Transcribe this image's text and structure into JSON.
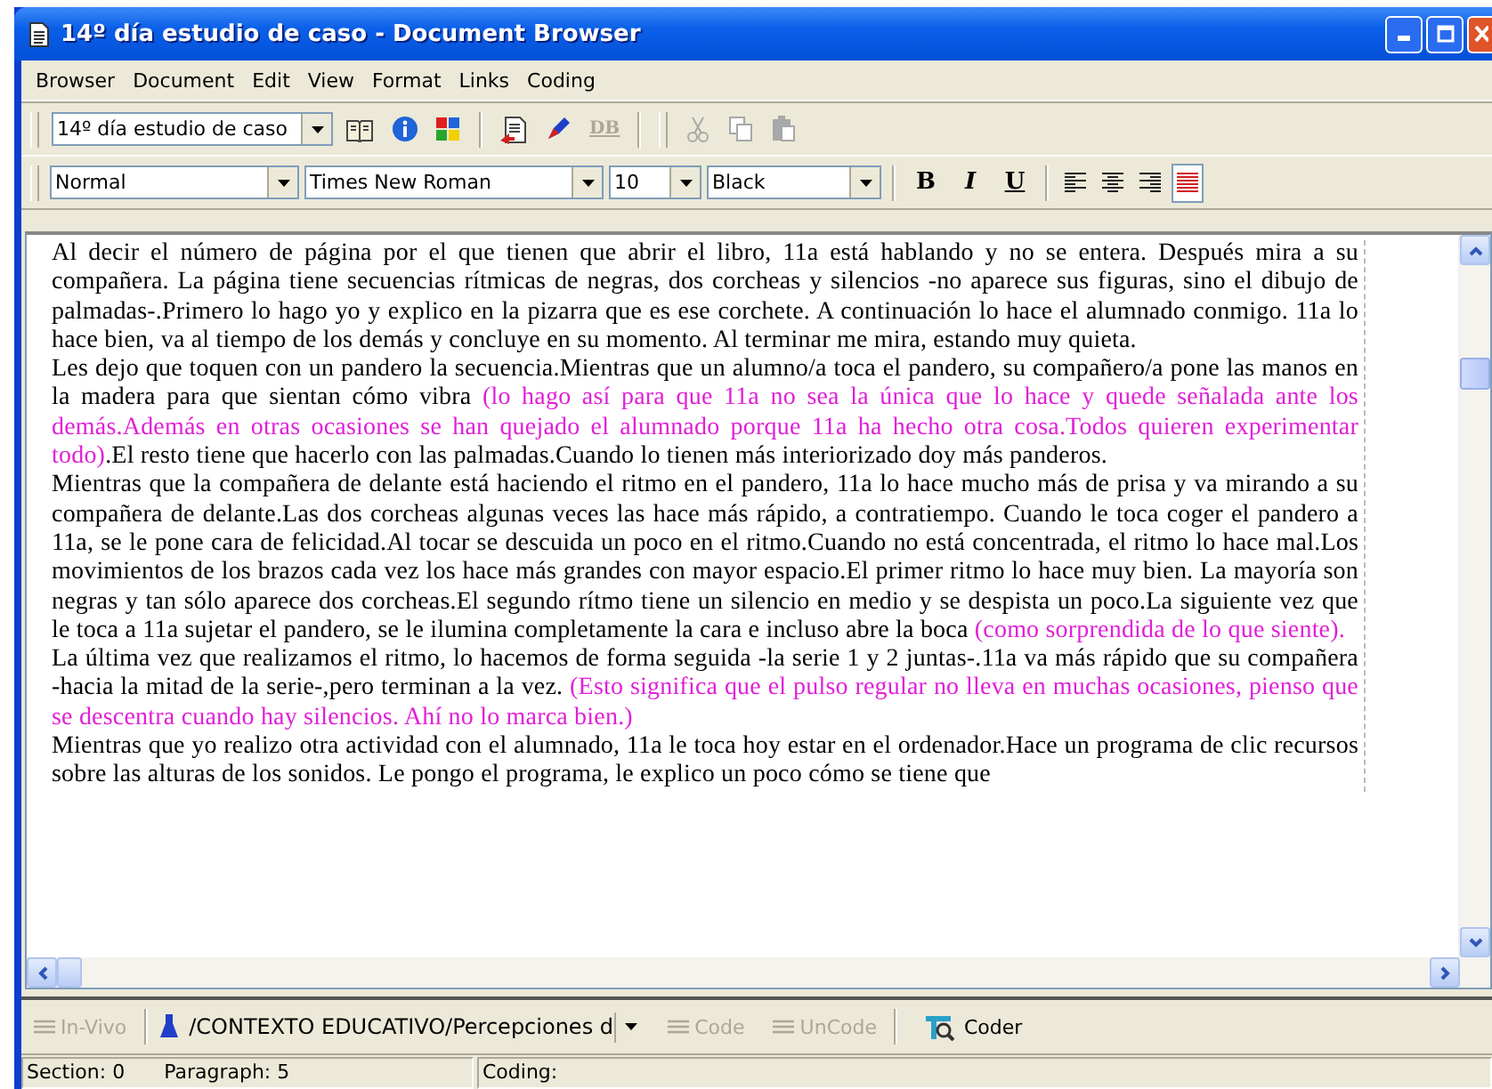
{
  "window": {
    "title": "14º día estudio de caso - Document Browser"
  },
  "menu": [
    "Browser",
    "Document",
    "Edit",
    "View",
    "Format",
    "Links",
    "Coding"
  ],
  "document_toolbar": {
    "document": "14º día estudio de caso",
    "db_button": {
      "label": "DB",
      "disabled": true
    },
    "edit_buttons": [
      {
        "disabled": true
      },
      {
        "disabled": true
      },
      {
        "disabled": true
      }
    ]
  },
  "format_toolbar": {
    "style": "Normal",
    "font": "Times New Roman",
    "size": "10",
    "text_color": "Black",
    "format_buttons": [
      {
        "label": "B",
        "pressed": false
      },
      {
        "label": "I",
        "pressed": false
      },
      {
        "label": "U",
        "pressed": false
      }
    ],
    "align_buttons": [
      {
        "pressed": false
      },
      {
        "pressed": false
      },
      {
        "pressed": false
      },
      {
        "pressed": true
      }
    ]
  },
  "document": {
    "paragraphs": [
      [
        {
          "kind": "text",
          "text": "Al decir el número de página por el que tienen que abrir el libro, 11a está hablando y no se entera. Después mira a su compañera. La página tiene secuencias rítmicas de negras, dos corcheas y silencios -no aparece sus figuras, sino el dibujo de palmadas-.Primero lo hago yo y explico en la pizarra que es ese corchete. A continuación lo hace el alumnado conmigo. 11a lo hace bien, va al tiempo de los demás y concluye en su momento. Al terminar me mira, estando muy quieta."
        }
      ],
      [
        {
          "kind": "text",
          "text": "Les dejo que toquen con un pandero la secuencia.Mientras que un alumno/a toca el pandero, su compañero/a pone las manos en la madera para que sientan cómo vibra "
        },
        {
          "kind": "memo",
          "text": "(lo hago así para que 11a no sea la única que lo hace y quede señalada ante los demás.Además en otras ocasiones se han quejado el alumnado porque 11a ha hecho otra cosa.Todos quieren experimentar todo)"
        },
        {
          "kind": "text",
          "text": ".El resto tiene que hacerlo con las palmadas.Cuando lo tienen más interiorizado doy más panderos."
        }
      ],
      [
        {
          "kind": "text",
          "text": "Mientras que la compañera de delante está haciendo el ritmo en el pandero, 11a lo hace mucho más de prisa y va mirando a su compañera de delante.Las dos corcheas algunas veces las hace más rápido, a contratiempo. Cuando le toca coger el pandero a 11a, se le pone cara de felicidad.Al tocar se descuida un poco en el ritmo.Cuando no está concentrada, el ritmo lo hace mal.Los movimientos de los brazos cada vez los hace más grandes con mayor espacio.El primer ritmo lo hace muy bien. La mayoría son negras y tan sólo aparece dos corcheas.El segundo rítmo tiene un silencio en medio y se despista un poco.La siguiente vez que le toca a 11a sujetar el pandero, se le ilumina completamente la cara e incluso abre la boca "
        },
        {
          "kind": "memo",
          "text": "(como sorprendida de lo que siente)."
        }
      ],
      [
        {
          "kind": "text",
          "text": "La última vez que realizamos el ritmo, lo hacemos de forma seguida -la serie 1 y 2 juntas-.11a va más rápido que su compañera -hacia la mitad de la serie-,pero terminan a la vez. "
        },
        {
          "kind": "memo",
          "text": "(Esto significa que el pulso regular no lleva en muchas ocasiones, pienso que se descentra cuando hay silencios. Ahí no lo marca bien.)"
        }
      ],
      [
        {
          "kind": "text",
          "text": "Mientras que yo realizo otra actividad con el alumnado, 11a le toca hoy estar en el ordenador.Hace un programa de clic recursos sobre las alturas de los sonidos. Le pongo el programa, le explico un poco cómo se tiene que"
        }
      ]
    ]
  },
  "code_toolbar": {
    "in_vivo": {
      "label": "In-Vivo",
      "disabled": true
    },
    "code_path": "/CONTEXTO EDUCATIVO/Percepciones d",
    "actions": [
      {
        "kind": "code",
        "label": "Code",
        "disabled": true
      },
      {
        "kind": "uncode",
        "label": "UnCode",
        "disabled": true
      },
      {
        "kind": "coder",
        "label": "Coder",
        "disabled": false
      }
    ]
  },
  "status_bar": {
    "section": "Section: 0",
    "paragraph": "Paragraph: 5",
    "coding": "Coding:"
  }
}
